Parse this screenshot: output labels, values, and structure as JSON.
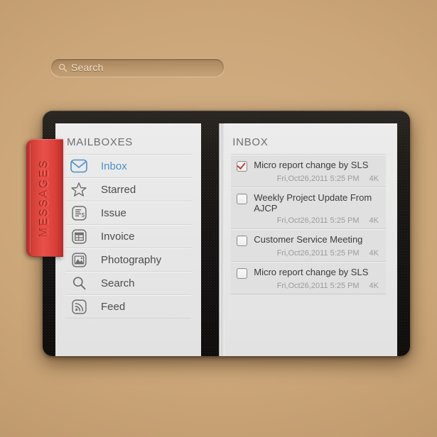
{
  "search": {
    "placeholder": "Search",
    "icon": "search-icon"
  },
  "bookmark": {
    "label": "MESSAGES",
    "color": "#d8443b"
  },
  "sidebar": {
    "title": "MAILBOXES",
    "items": [
      {
        "label": "Inbox",
        "icon": "envelope-icon",
        "active": true
      },
      {
        "label": "Starred",
        "icon": "star-icon",
        "active": false
      },
      {
        "label": "Issue",
        "icon": "invoice-doc-icon",
        "active": false
      },
      {
        "label": "Invoice",
        "icon": "table-icon",
        "active": false
      },
      {
        "label": "Photography",
        "icon": "image-icon",
        "active": false
      },
      {
        "label": "Search",
        "icon": "search-icon",
        "active": false
      },
      {
        "label": "Feed",
        "icon": "rss-icon",
        "active": false
      }
    ],
    "active_color": "#4a90c8"
  },
  "inbox": {
    "title": "INBOX",
    "emails": [
      {
        "subject": "Micro report change by SLS",
        "date": "Fri,Oct26,2011 5:25 PM",
        "size": "4K",
        "checked": true
      },
      {
        "subject": "Weekly Project Update From AJCP",
        "date": "Fri,Oct26,2011 5:25 PM",
        "size": "4K",
        "checked": false
      },
      {
        "subject": "Customer Service Meeting",
        "date": "Fri,Oct26,2011 5:25 PM",
        "size": "4K",
        "checked": false
      },
      {
        "subject": "Micro report change by SLS",
        "date": "Fri,Oct26,2011 5:25 PM",
        "size": "4K",
        "checked": false
      }
    ]
  }
}
